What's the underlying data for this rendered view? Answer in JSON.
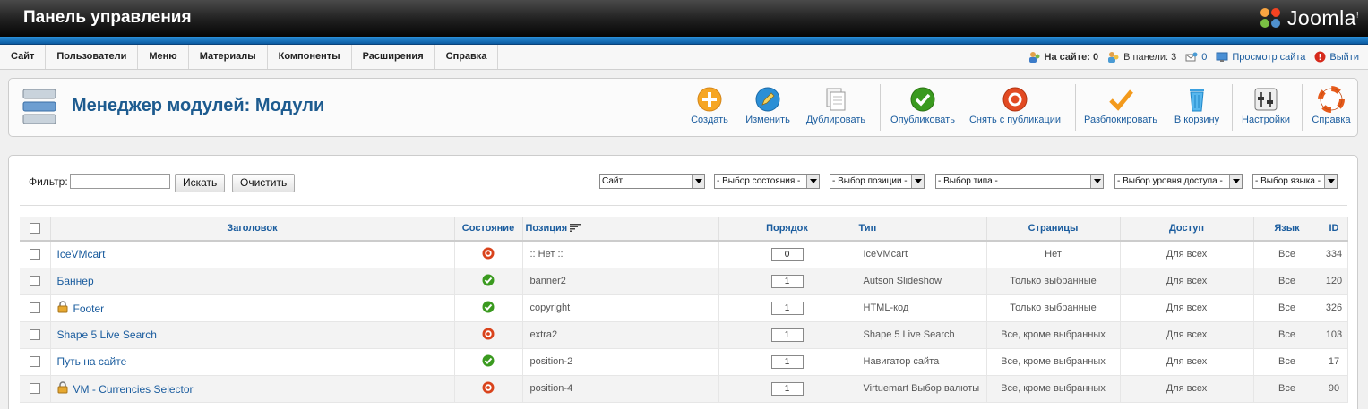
{
  "header": {
    "title": "Панель управления",
    "logo_text": "Joomla!"
  },
  "menu": [
    "Сайт",
    "Пользователи",
    "Меню",
    "Материалы",
    "Компоненты",
    "Расширения",
    "Справка"
  ],
  "status": {
    "online_site": "На сайте: 0",
    "online_admin": "В панели: 3",
    "messages": "0",
    "view_site": "Просмотр сайта",
    "logout": "Выйти"
  },
  "page": {
    "title": "Менеджер модулей: Модули"
  },
  "toolbar": {
    "new": "Создать",
    "edit": "Изменить",
    "duplicate": "Дублировать",
    "publish": "Опубликовать",
    "unpublish": "Снять с публикации",
    "checkin": "Разблокировать",
    "trash": "В корзину",
    "options": "Настройки",
    "help": "Справка"
  },
  "filters": {
    "label": "Фильтр:",
    "search_value": "",
    "search_button": "Искать",
    "clear_button": "Очистить",
    "client": "Сайт",
    "state": "- Выбор состояния -",
    "position": "- Выбор позиции -",
    "type": "- Выбор типа -",
    "access": "- Выбор уровня доступа -",
    "language": "- Выбор языка -"
  },
  "table": {
    "columns": [
      "Заголовок",
      "Состояние",
      "Позиция",
      "Порядок",
      "Тип",
      "Страницы",
      "Доступ",
      "Язык",
      "ID"
    ],
    "rows": [
      {
        "title": "IceVMcart",
        "locked": false,
        "state": "unpublished",
        "position": ":: Нет ::",
        "order": "0",
        "type": "IceVMcart",
        "pages": "Нет",
        "access": "Для всех",
        "language": "Все",
        "id": "334"
      },
      {
        "title": "Баннер",
        "locked": false,
        "state": "published",
        "position": "banner2",
        "order": "1",
        "type": "Autson Slideshow",
        "pages": "Только выбранные",
        "access": "Для всех",
        "language": "Все",
        "id": "120"
      },
      {
        "title": "Footer",
        "locked": true,
        "state": "published",
        "position": "copyright",
        "order": "1",
        "type": "HTML-код",
        "pages": "Только выбранные",
        "access": "Для всех",
        "language": "Все",
        "id": "326"
      },
      {
        "title": "Shape 5 Live Search",
        "locked": false,
        "state": "unpublished",
        "position": "extra2",
        "order": "1",
        "type": "Shape 5 Live Search",
        "pages": "Все, кроме выбранных",
        "access": "Для всех",
        "language": "Все",
        "id": "103"
      },
      {
        "title": "Путь на сайте",
        "locked": false,
        "state": "published",
        "position": "position-2",
        "order": "1",
        "type": "Навигатор сайта",
        "pages": "Все, кроме выбранных",
        "access": "Для всех",
        "language": "Все",
        "id": "17"
      },
      {
        "title": "VM - Currencies Selector",
        "locked": true,
        "state": "unpublished",
        "position": "position-4",
        "order": "1",
        "type": "Virtuemart Выбор валюты",
        "pages": "Все, кроме выбранных",
        "access": "Для всех",
        "language": "Все",
        "id": "90"
      }
    ]
  },
  "colors": {
    "accent": "#1a5c9e",
    "published": "#3a9a1f",
    "unpublished": "#d9431c",
    "header_blue": "#0b5aa0"
  }
}
